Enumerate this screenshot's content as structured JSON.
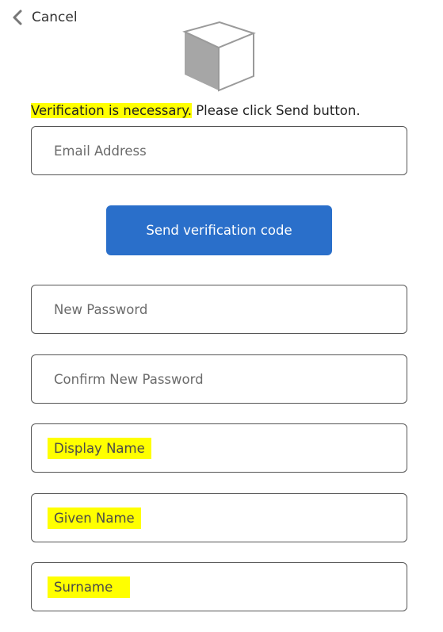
{
  "header": {
    "cancel_label": "Cancel"
  },
  "intro": {
    "highlighted": "Verification is necessary.",
    "rest": " Please click Send button."
  },
  "form": {
    "email_placeholder": "Email Address",
    "send_label": "Send verification code",
    "new_password_placeholder": "New Password",
    "confirm_password_placeholder": "Confirm New Password",
    "display_name_placeholder": "Display Name",
    "given_name_placeholder": "Given Name",
    "surname_placeholder": "Surname"
  },
  "colors": {
    "accent": "#2a6fca",
    "highlight": "#ffff00"
  },
  "icons": {
    "back": "chevron-left-icon",
    "logo": "cube-logo-icon"
  }
}
